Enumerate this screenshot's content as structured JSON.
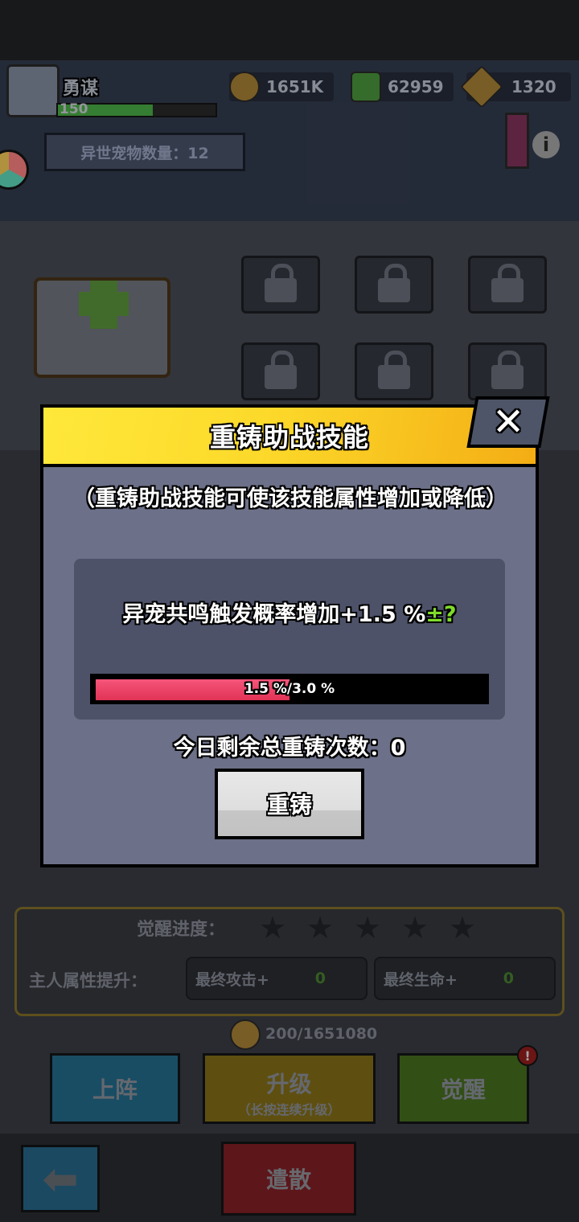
{
  "player": {
    "name": "勇谋",
    "level": "150",
    "level_progress": 0.6
  },
  "currencies": [
    {
      "icon": "coin-icon",
      "value": "1651K",
      "color": "#8a6a2c"
    },
    {
      "icon": "gem-cube-icon",
      "value": "62959",
      "color": "#3d7a32"
    },
    {
      "icon": "star-shard-icon",
      "value": "1320",
      "color": "#8a6a2c"
    }
  ],
  "pet_count_label": "异世宠物数量：12",
  "awakening": {
    "progress_label": "觉醒进度：",
    "stars_total": 5,
    "stars_filled": 0,
    "boost_label": "主人属性提升：",
    "stat_attack_label": "最终攻击+",
    "stat_attack_value": "0",
    "stat_hp_label": "最终生命+",
    "stat_hp_value": "0"
  },
  "cost_text": "200/1651080",
  "buttons": {
    "deploy": "上阵",
    "upgrade": "升级",
    "upgrade_hint": "（长按连续升级）",
    "awaken": "觉醒",
    "awaken_badge": "!",
    "disband": "遣散",
    "back_icon": "back-arrow-icon"
  },
  "dialog": {
    "title": "重铸助战技能",
    "close_label": "✕",
    "description": "（重铸助战技能可使该技能属性增加或降低）",
    "skill_text": "异宠共鸣触发概率增加+1.5 %",
    "skill_suffix": "±?",
    "progress_label": "1.5 %/3.0 %",
    "progress_current": 1.5,
    "progress_max": 3.0,
    "remaining_label": "今日剩余总重铸次数：0",
    "recast_button": "重铸"
  },
  "colors": {
    "header_yellow": "#fcd92a",
    "header_orange": "#f4ad14",
    "dialog_body": "#6c7088",
    "progress_fill": "#f6557a",
    "suffix_green": "#7fdc2a"
  }
}
